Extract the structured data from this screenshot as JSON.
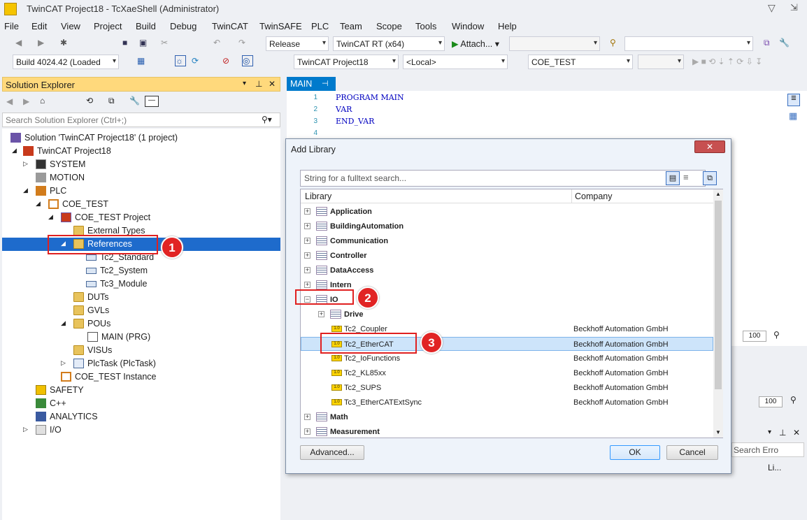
{
  "window": {
    "title": "TwinCAT Project18 - TcXaeShell (Administrator)"
  },
  "menu": [
    "File",
    "Edit",
    "View",
    "Project",
    "Build",
    "Debug",
    "TwinCAT",
    "TwinSAFE",
    "PLC",
    "Team",
    "Scope",
    "Tools",
    "Window",
    "Help"
  ],
  "toolbar": {
    "configuration": "Release",
    "platform": "TwinCAT RT (x64)",
    "attach_label": "Attach...",
    "build_info": "Build 4024.42 (Loaded",
    "project": "TwinCAT Project18",
    "target": "<Local>",
    "plc_project": "COE_TEST"
  },
  "solution_explorer": {
    "title": "Solution Explorer",
    "search_placeholder": "Search Solution Explorer (Ctrl+;)",
    "nodes": [
      "Solution 'TwinCAT Project18' (1 project)",
      "TwinCAT Project18",
      "SYSTEM",
      "MOTION",
      "PLC",
      "COE_TEST",
      "COE_TEST Project",
      "External Types",
      "References",
      "Tc2_Standard",
      "Tc2_System",
      "Tc3_Module",
      "DUTs",
      "GVLs",
      "POUs",
      "MAIN (PRG)",
      "VISUs",
      "PlcTask (PlcTask)",
      "COE_TEST Instance",
      "SAFETY",
      "C++",
      "ANALYTICS",
      "I/O"
    ]
  },
  "editor": {
    "tab": "MAIN",
    "lines": [
      {
        "n": "1",
        "text": "PROGRAM MAIN"
      },
      {
        "n": "2",
        "text": "VAR"
      },
      {
        "n": "3",
        "text": "END_VAR"
      },
      {
        "n": "4",
        "text": ""
      }
    ],
    "zoom": "100"
  },
  "dialog": {
    "title": "Add Library",
    "search_placeholder": "String for a fulltext search...",
    "col_library": "Library",
    "col_company": "Company",
    "categories": [
      "Application",
      "BuildingAutomation",
      "Communication",
      "Controller",
      "DataAccess",
      "Intern",
      "IO"
    ],
    "io_children": [
      {
        "name": "Drive",
        "company": ""
      },
      {
        "name": "Tc2_Coupler",
        "company": "Beckhoff Automation GmbH"
      },
      {
        "name": "Tc2_EtherCAT",
        "company": "Beckhoff Automation GmbH"
      },
      {
        "name": "Tc2_IoFunctions",
        "company": "Beckhoff Automation GmbH"
      },
      {
        "name": "Tc2_KL85xx",
        "company": "Beckhoff Automation GmbH"
      },
      {
        "name": "Tc2_SUPS",
        "company": "Beckhoff Automation GmbH"
      },
      {
        "name": "Tc3_EtherCATExtSync",
        "company": "Beckhoff Automation GmbH"
      }
    ],
    "after": [
      "Math",
      "Measurement"
    ],
    "advanced": "Advanced...",
    "ok": "OK",
    "cancel": "Cancel"
  },
  "error_panel": {
    "search": "Search Erro",
    "col": "Li..."
  },
  "badges": [
    "1",
    "2",
    "3"
  ],
  "colors": {
    "accent": "#007acc",
    "selection": "#1e6bcc",
    "panel_header": "#ffd97c",
    "badge": "#e12424"
  }
}
